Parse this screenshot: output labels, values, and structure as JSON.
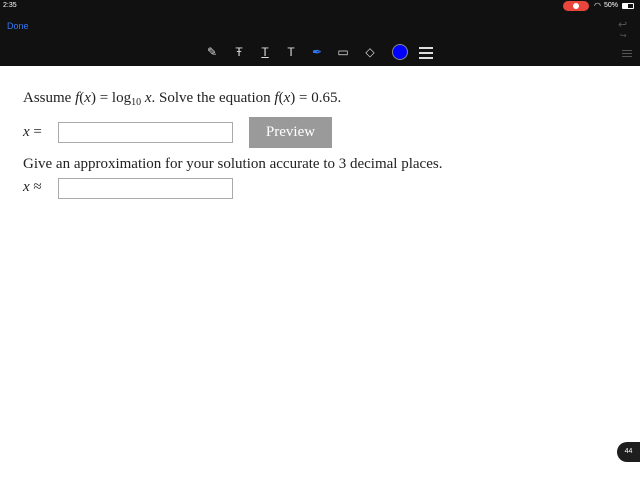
{
  "status_bar": {
    "time": "2:35",
    "battery": "50%",
    "battery_level": 0.5
  },
  "header": {
    "done_label": "Done",
    "undo_icon": "undo-icon",
    "redo_icon": "redo-icon"
  },
  "toolbar": {
    "tools": [
      "pencil-icon",
      "text-strike-icon",
      "text-underline-icon",
      "text-icon",
      "pen-icon",
      "comment-icon",
      "eraser-icon"
    ],
    "color": "#0000ff"
  },
  "problem": {
    "assume": "Assume",
    "f": "f",
    "x": "x",
    "equals": "=",
    "log": "log",
    "log_base": "10",
    "solve_text": ". Solve the equation",
    "value": "0.65",
    "answer_label_x": "x",
    "answer_label_eq": "=",
    "answer_value": "",
    "preview_label": "Preview",
    "approx_text": "Give an approximation for your solution accurate to 3 decimal places.",
    "approx_label_x": "x",
    "approx_symbol": "≈",
    "approx_value": ""
  },
  "page_number": "44"
}
